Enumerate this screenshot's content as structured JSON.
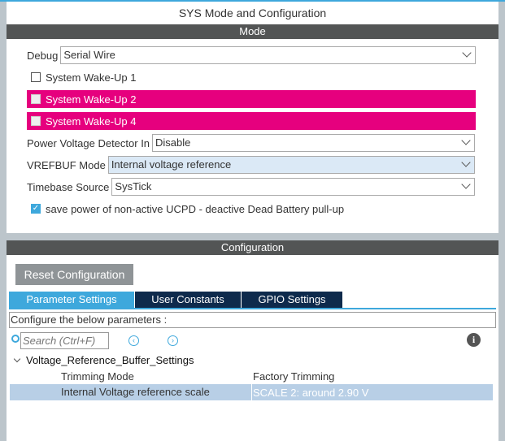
{
  "window_title": "SYS Mode and Configuration",
  "mode": {
    "header": "Mode",
    "debug": {
      "label": "Debug",
      "value": "Serial Wire"
    },
    "wakeups": [
      {
        "label": "System Wake-Up 1",
        "checked": false,
        "highlighted": false
      },
      {
        "label": "System Wake-Up 2",
        "checked": false,
        "highlighted": true
      },
      {
        "label": "System Wake-Up 4",
        "checked": false,
        "highlighted": true
      }
    ],
    "pvd": {
      "label": "Power Voltage Detector In",
      "value": "Disable"
    },
    "vrefbuf": {
      "label": "VREFBUF Mode",
      "value": "Internal voltage reference"
    },
    "timebase": {
      "label": "Timebase Source",
      "value": "SysTick"
    },
    "ucpd": {
      "label": "save power of non-active UCPD - deactive Dead Battery pull-up",
      "checked": true
    }
  },
  "configuration": {
    "header": "Configuration",
    "reset_label": "Reset Configuration",
    "tabs": [
      {
        "label": "Parameter Settings",
        "active": true
      },
      {
        "label": "User Constants",
        "active": false
      },
      {
        "label": "GPIO Settings",
        "active": false
      }
    ],
    "configure_text": "Configure the below parameters :",
    "search_placeholder": "Search (Ctrl+F)",
    "group": "Voltage_Reference_Buffer_Settings",
    "params": [
      {
        "name": "Trimming Mode",
        "value": "Factory Trimming",
        "selected": false
      },
      {
        "name": "Internal Voltage reference scale",
        "value": "SCALE 2: around 2.90 V",
        "selected": true
      }
    ]
  },
  "colors": {
    "accent": "#3ea8dc",
    "highlight": "#e6007e",
    "header": "#535555",
    "tab_inactive": "#0e2a4c",
    "selected_row": "#b8cfe6"
  }
}
